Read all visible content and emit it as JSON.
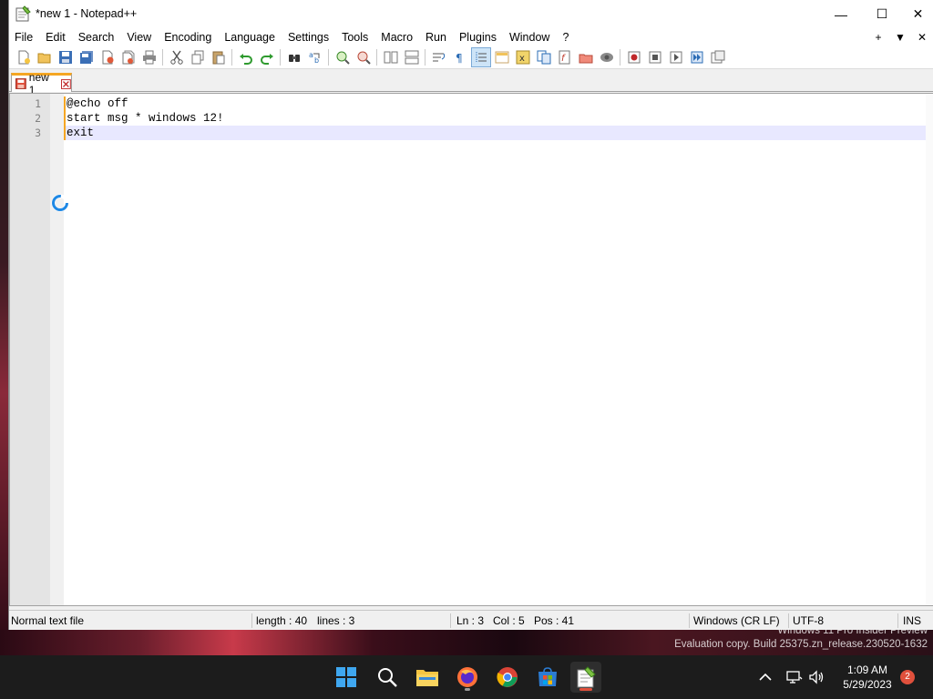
{
  "window": {
    "title": "*new 1 - Notepad++",
    "minimize_glyph": "—",
    "maximize_glyph": "☐",
    "close_glyph": "✕"
  },
  "menu": {
    "items": [
      "File",
      "Edit",
      "Search",
      "View",
      "Encoding",
      "Language",
      "Settings",
      "Tools",
      "Macro",
      "Run",
      "Plugins",
      "Window",
      "?"
    ],
    "right": [
      "+",
      "▼",
      "✕"
    ]
  },
  "toolbar": {
    "icons": [
      "new-file-icon",
      "open-file-icon",
      "save-icon",
      "save-all-icon",
      "close-icon",
      "close-all-icon",
      "print-icon",
      "cut-icon",
      "copy-icon",
      "paste-icon",
      "undo-icon",
      "redo-icon",
      "find-icon",
      "replace-icon",
      "zoom-in-icon",
      "zoom-out-icon",
      "sync-vertical-icon",
      "sync-horizontal-icon",
      "word-wrap-icon",
      "show-all-chars-icon",
      "indent-guide-icon",
      "udl-icon",
      "doc-map-icon",
      "function-list-icon",
      "folder-workspace-icon",
      "monitoring-icon",
      "record-macro-icon",
      "stop-macro-icon",
      "play-macro-icon",
      "run-macro-multiple-icon",
      "save-macro-icon"
    ],
    "active_icon": "indent-guide-icon"
  },
  "tab": {
    "label": "new 1"
  },
  "editor": {
    "lines": [
      {
        "num": "1",
        "text": "@echo off"
      },
      {
        "num": "2",
        "text": "start msg * windows 12!"
      },
      {
        "num": "3",
        "text": "exit"
      }
    ],
    "current_line": 3
  },
  "statusbar": {
    "file_type": "Normal text file",
    "length": "length : 40",
    "lines": "lines : 3",
    "ln": "Ln : 3",
    "col": "Col : 5",
    "pos": "Pos : 41",
    "eol": "Windows (CR LF)",
    "encoding": "UTF-8",
    "mode": "INS"
  },
  "watermark": {
    "line1": "Windows 11 Pro Insider Preview",
    "line2": "Evaluation copy. Build 25375.zn_release.230520-1632"
  },
  "taskbar": {
    "apps": [
      "start-icon",
      "search-icon",
      "file-explorer-icon",
      "firefox-icon",
      "chrome-icon",
      "microsoft-store-icon",
      "notepadpp-icon"
    ],
    "time": "1:09 AM",
    "date": "5/29/2023",
    "notification_count": "2"
  },
  "colors": {
    "tab_accent": "#f5a623",
    "current_line": "#e8e8ff",
    "notification": "#e0503c"
  }
}
